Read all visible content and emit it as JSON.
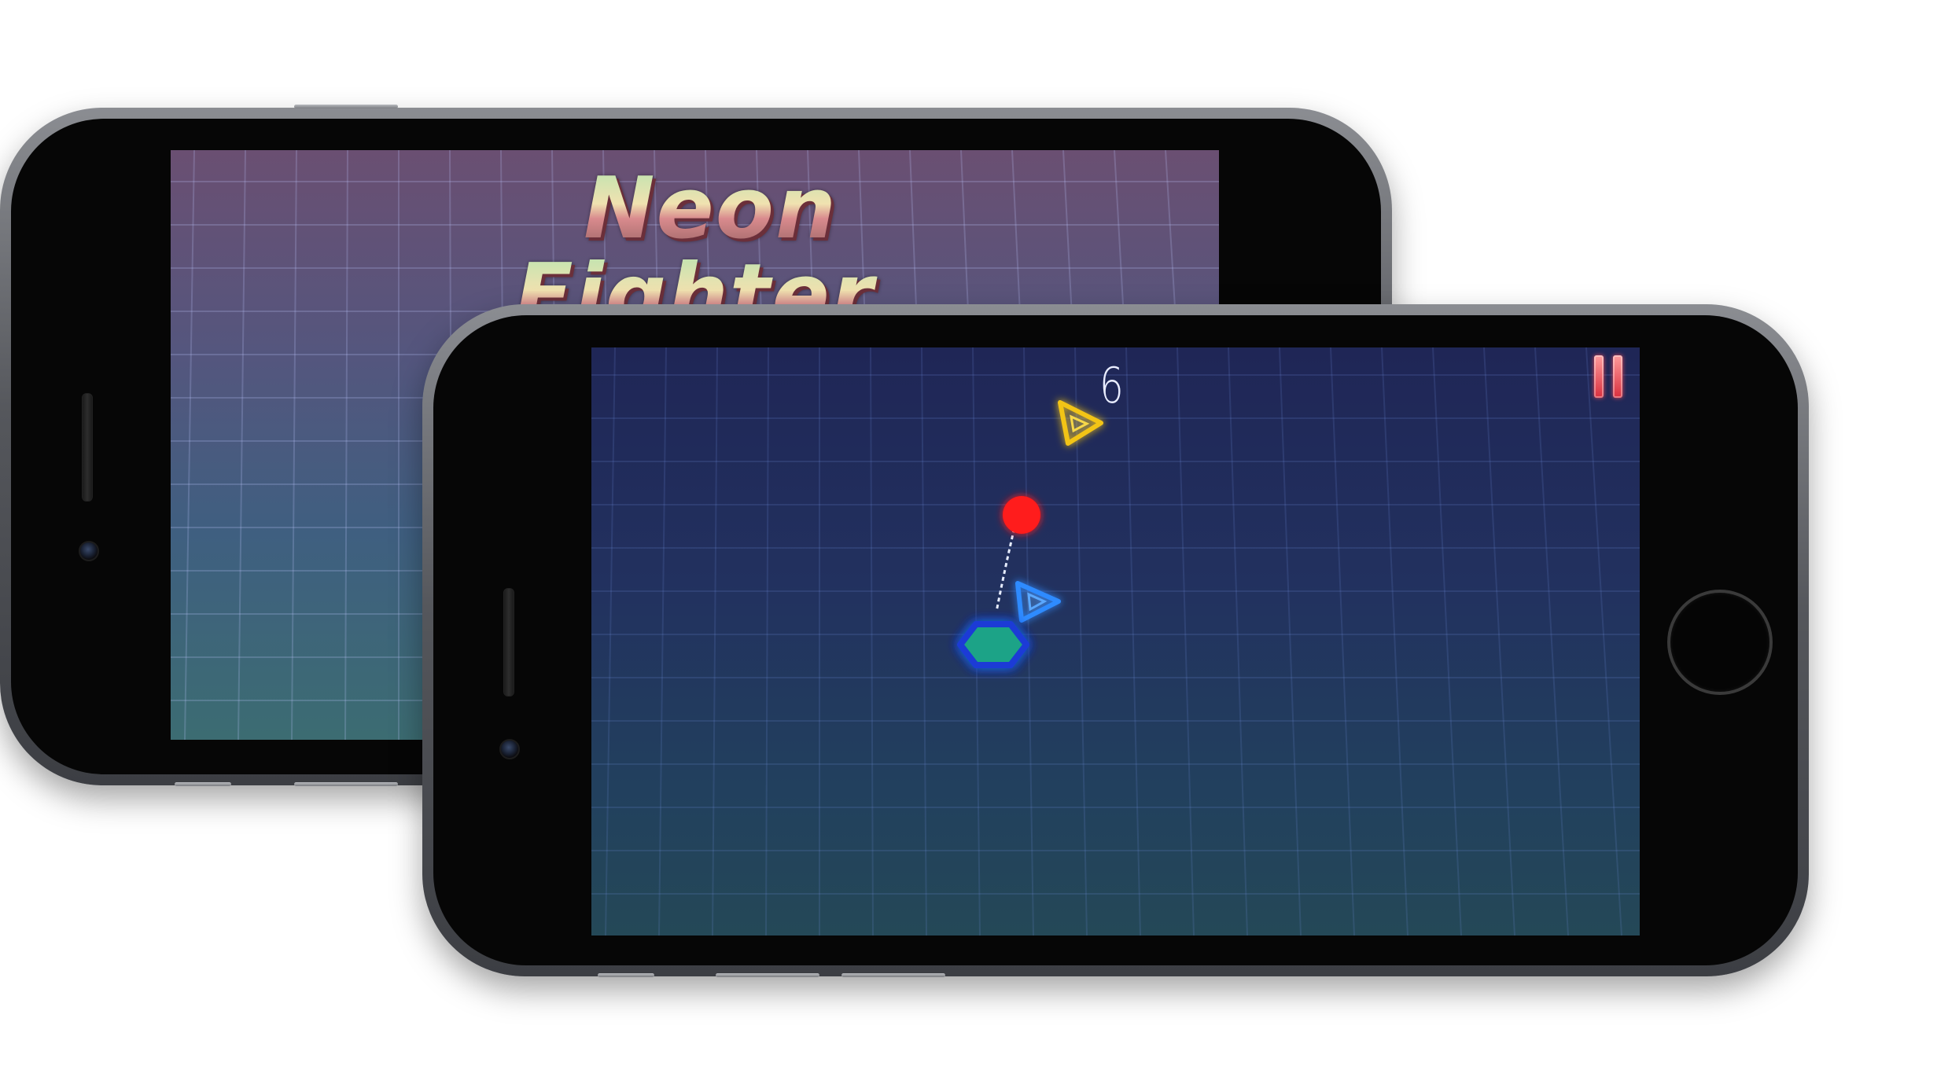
{
  "back_screen": {
    "title_line1": "Neon",
    "title_line2": "Fighter"
  },
  "game_screen": {
    "score": "6",
    "pause_icon": "pause-icon"
  },
  "colors": {
    "enemy_yellow": "#f2c417",
    "enemy_blue": "#2f8bff",
    "player_green": "#1aa387",
    "player_outline": "#1a3ad6",
    "target_red": "#ff1a1a",
    "pause_red": "#d92f3e"
  }
}
